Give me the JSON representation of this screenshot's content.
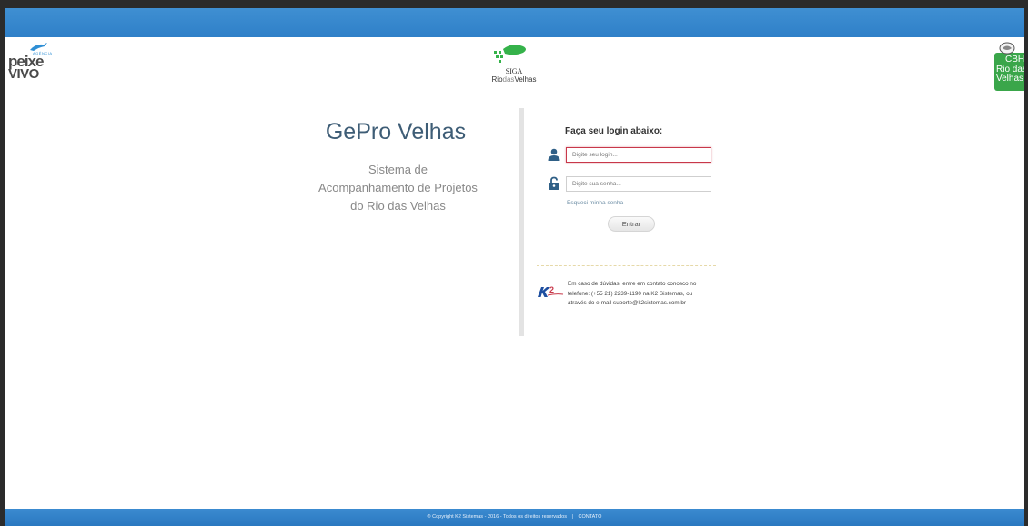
{
  "brand": {
    "peixe_vivo": {
      "agencia": "AGÊNCIA",
      "line1": "peixe",
      "line2": "VIVO"
    },
    "siga": {
      "line1": "SIGA",
      "rio": "Rio",
      "das": "das",
      "velhas": "Velhas"
    },
    "cbh": {
      "line1": "CBH",
      "line2": "Rio das",
      "line3": "Velhas",
      "color": "#3aa64a"
    }
  },
  "app": {
    "title": "GePro Velhas",
    "subtitle_line1": "Sistema de",
    "subtitle_line2": "Acompanhamento de Projetos",
    "subtitle_line3": "do Rio das Velhas"
  },
  "login": {
    "heading": "Faça seu login abaixo:",
    "login_placeholder": "Digite seu login...",
    "password_placeholder": "Digite sua senha...",
    "forgot_label": "Esqueci minha senha",
    "submit_label": "Entrar"
  },
  "contact": {
    "line1": "Em caso de dúvidas, entre em contato conosco no",
    "line2": "telefone: (+55 21) 2239-1190 na K2 Sistemas, ou",
    "line3": "através do e-mail suporte@k2sistemas.com.br"
  },
  "footer": {
    "copyright": "® Copyright K2 Sistemas - 2016 - Todos os direitos reservados",
    "separator": "|",
    "contact_link": "CONTATO"
  },
  "colors": {
    "topbar": "#2f80c8",
    "title": "#3e5d76",
    "focus_border": "#c8384a",
    "icon": "#2f5f86"
  },
  "icons": {
    "user": "user-icon",
    "lock": "lock-icon",
    "k2": "k2-logo"
  }
}
